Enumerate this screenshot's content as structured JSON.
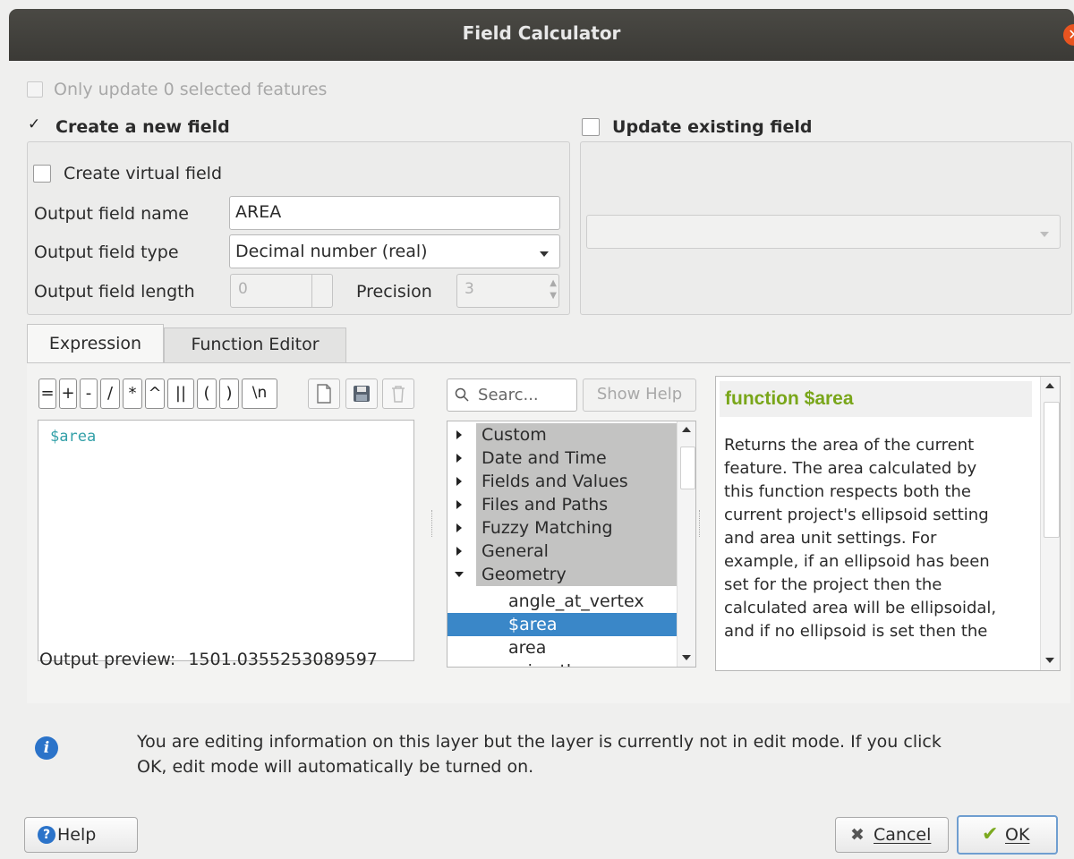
{
  "window": {
    "title": "Field Calculator"
  },
  "only_update": {
    "label": "Only update 0 selected features",
    "checked": false,
    "enabled": false
  },
  "create_field": {
    "label": "Create a new field",
    "checked": true,
    "virtual_label": "Create virtual field",
    "name_label": "Output field name",
    "name_value": "AREA",
    "type_label": "Output field type",
    "type_value": "Decimal number (real)",
    "length_label": "Output field length",
    "length_value": "0",
    "precision_label": "Precision",
    "precision_value": "3"
  },
  "update_field": {
    "label": "Update existing field",
    "checked": false,
    "combo_value": ""
  },
  "tabs": [
    {
      "label": "Expression",
      "active": true
    },
    {
      "label": "Function Editor",
      "active": false
    }
  ],
  "toolbar": {
    "operators": [
      "=",
      "+",
      "-",
      "/",
      "*",
      "^",
      "||",
      "(",
      ")",
      "\\n"
    ]
  },
  "editor": {
    "expression": "$area"
  },
  "preview": {
    "label": "Output preview:",
    "value": "1501.0355253089597"
  },
  "search": {
    "placeholder": "Searc...",
    "show_help": "Show Help"
  },
  "function_tree": {
    "categories": [
      "Custom",
      "Date and Time",
      "Fields and Values",
      "Files and Paths",
      "Fuzzy Matching",
      "General",
      "Geometry"
    ],
    "children": [
      "angle_at_vertex",
      "$area",
      "area",
      "azimuth"
    ],
    "selected": "$area"
  },
  "help": {
    "title": "function $area",
    "lines": [
      "Returns the area of the current",
      "feature. The area calculated by",
      "this function respects both the",
      "current project's ellipsoid setting",
      "and area unit settings. For",
      "example, if an ellipsoid has been",
      "set for the project then the",
      "calculated area will be ellipsoidal,",
      "and if no ellipsoid is set then the"
    ]
  },
  "message": {
    "line1": "You are editing information on this layer but the layer is currently not in edit mode. If you click",
    "line2": "OK, edit mode will automatically be turned on."
  },
  "buttons": {
    "help": "Help",
    "cancel": "Cancel",
    "ok": "OK"
  },
  "colors": {
    "accent": "#e95420",
    "selection": "#3a87c8",
    "help_title": "#79a61a",
    "keyword": "#33a0a8",
    "info": "#2b73c9"
  }
}
